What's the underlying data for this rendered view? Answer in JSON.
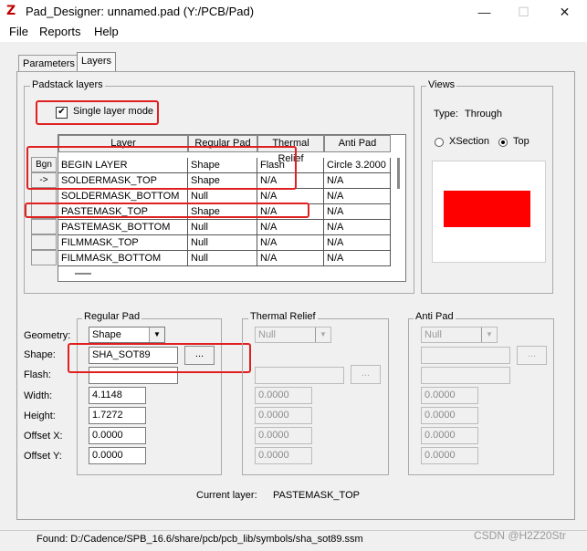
{
  "window": {
    "title": "Pad_Designer: unnamed.pad (Y:/PCB/Pad)",
    "minimize": "—",
    "maximize": "☐",
    "close": "✕",
    "app_icon": "Z"
  },
  "menu": [
    "File",
    "Reports",
    "Help"
  ],
  "tabs": [
    "Parameters",
    "Layers"
  ],
  "padstack": {
    "group_label": "Padstack layers",
    "single_layer_mode": {
      "label": "Single layer mode",
      "checked": true
    },
    "columns": [
      "Layer",
      "Regular Pad",
      "Thermal Relief",
      "Anti Pad"
    ],
    "row_buttons": [
      "Bgn",
      "->",
      "",
      "",
      "",
      "",
      ""
    ],
    "rows": [
      [
        "BEGIN LAYER",
        "Shape",
        "Flash",
        "Circle 3.2000"
      ],
      [
        "SOLDERMASK_TOP",
        "Shape",
        "N/A",
        "N/A"
      ],
      [
        "SOLDERMASK_BOTTOM",
        "Null",
        "N/A",
        "N/A"
      ],
      [
        "PASTEMASK_TOP",
        "Shape",
        "N/A",
        "N/A"
      ],
      [
        "PASTEMASK_BOTTOM",
        "Null",
        "N/A",
        "N/A"
      ],
      [
        "FILMMASK_TOP",
        "Null",
        "N/A",
        "N/A"
      ],
      [
        "FILMMASK_BOTTOM",
        "Null",
        "N/A",
        "N/A"
      ]
    ]
  },
  "views": {
    "label": "Views",
    "type_label": "Type:",
    "type_value": "Through",
    "xsection_label": "XSection",
    "top_label": "Top",
    "selected": "Top",
    "preview_color": "#ff0000"
  },
  "fields": {
    "geometry": "Geometry:",
    "shape": "Shape:",
    "flash": "Flash:",
    "width": "Width:",
    "height": "Height:",
    "offset_x": "Offset X:",
    "offset_y": "Offset Y:"
  },
  "regular_pad": {
    "label": "Regular Pad",
    "geometry": "Shape",
    "shape": "SHA_SOT89",
    "browse": "...",
    "flash": "",
    "width": "4.1148",
    "height": "1.7272",
    "offset_x": "0.0000",
    "offset_y": "0.0000"
  },
  "thermal_relief": {
    "label": "Thermal Relief",
    "geometry": "Null",
    "browse": "...",
    "width": "0.0000",
    "height": "0.0000",
    "offset_x": "0.0000",
    "offset_y": "0.0000"
  },
  "anti_pad": {
    "label": "Anti Pad",
    "geometry": "Null",
    "browse": "...",
    "width": "0.0000",
    "height": "0.0000",
    "offset_x": "0.0000",
    "offset_y": "0.0000"
  },
  "current_layer": {
    "label": "Current layer:",
    "value": "PASTEMASK_TOP"
  },
  "status": "Found: D:/Cadence/SPB_16.6/share/pcb/pcb_lib/symbols/sha_sot89.ssm",
  "watermark": "CSDN @H2Z20Str",
  "accent_colors": {
    "highlight_box": "#e02020",
    "preview_fill": "#ff0000"
  }
}
